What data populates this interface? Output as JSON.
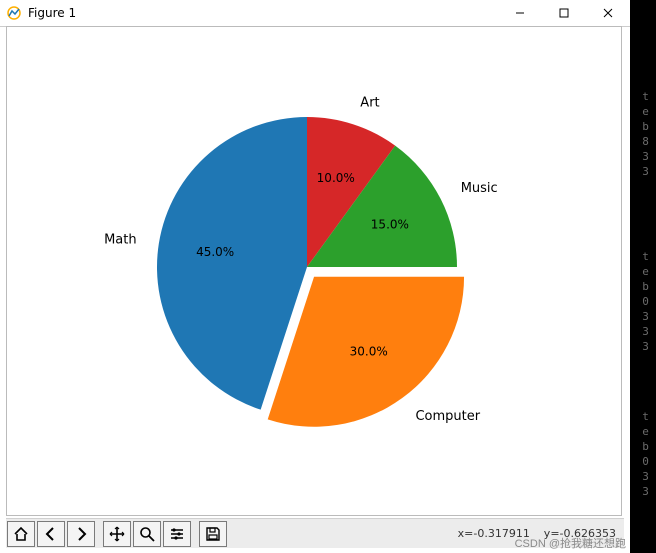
{
  "window": {
    "title": "Figure 1"
  },
  "toolbar": {
    "coords": "x=-0.317911    y=-0.626353"
  },
  "watermark": "CSDN @抢我糖还想跑",
  "right_strip": {
    "t1": "teb833",
    "t2": "teb0333",
    "t3": "teb033"
  },
  "chart_data": {
    "type": "pie",
    "title": "",
    "explode_index": 3,
    "start_angle_deg": 90,
    "counterclockwise": false,
    "slices": [
      {
        "label": "Art",
        "value": 10.0,
        "pct_label": "10.0%",
        "color": "#d62728",
        "explode": 0
      },
      {
        "label": "Music",
        "value": 15.0,
        "pct_label": "15.0%",
        "color": "#2ca02c",
        "explode": 0
      },
      {
        "label": "Computer",
        "value": 30.0,
        "pct_label": "30.0%",
        "color": "#ff7f0e",
        "explode": 0.08
      },
      {
        "label": "Math",
        "value": 45.0,
        "pct_label": "45.0%",
        "color": "#1f77b4",
        "explode": 0
      }
    ]
  }
}
